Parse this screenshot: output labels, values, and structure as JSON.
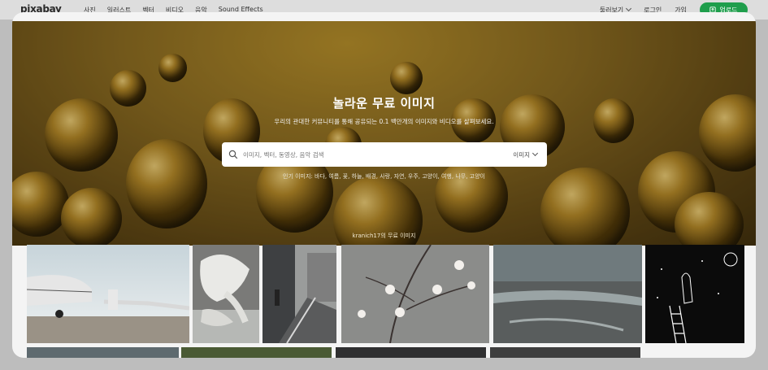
{
  "nav": {
    "logo": "pixabay",
    "links": [
      "사진",
      "일러스트",
      "벡터",
      "비디오",
      "음악",
      "Sound Effects"
    ],
    "explore": "둘러보기",
    "login": "로그인",
    "join": "가입",
    "upload": "업로드"
  },
  "hero": {
    "title": "놀라운 무료 이미지",
    "subtitle": "우리의 관대한 커뮤니티를 통해 공유되는 0.1 백만개의 이미지와 비디오를 살펴보세요.",
    "search_placeholder": "이미지, 벡터, 동영상, 음악 검색",
    "search_type": "이미지",
    "popular": "인기 이미지: 바다, 여름, 꽃, 하늘, 배경, 사랑, 자연, 우주, 고양이, 여행, 나무, 고양이",
    "credit": "kranich17의 무료 이미지"
  },
  "colors": {
    "accent": "#1f9e4c",
    "topbar": "#dddddd",
    "frame": "#f4f4f4"
  },
  "icons": {
    "search": "search-icon",
    "upload": "upload-icon",
    "chevron": "chevron-down-icon"
  }
}
